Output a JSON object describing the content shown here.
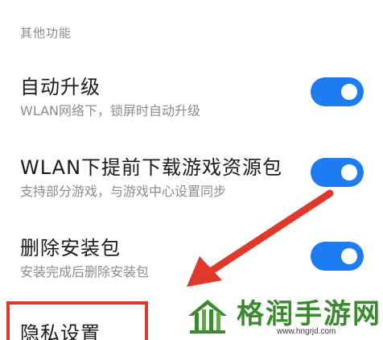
{
  "section": {
    "title": "其他功能"
  },
  "settings": [
    {
      "title": "自动升级",
      "desc": "WLAN网络下，锁屏时自动升级",
      "enabled": true
    },
    {
      "title": "WLAN下提前下载游戏资源包",
      "desc": "支持部分游戏，与游戏中心设置同步",
      "enabled": true
    },
    {
      "title": "删除安装包",
      "desc": "安装完成后删除安装包",
      "enabled": true
    }
  ],
  "privacy": {
    "title": "隐私设置"
  },
  "annotation": {
    "highlight_color": "#e0392c"
  },
  "watermark": {
    "name": "格润手游网",
    "url": "www.hngrjd.com"
  },
  "colors": {
    "toggle_on": "#1e7cf2",
    "watermark_green": "#3a8a2e"
  }
}
